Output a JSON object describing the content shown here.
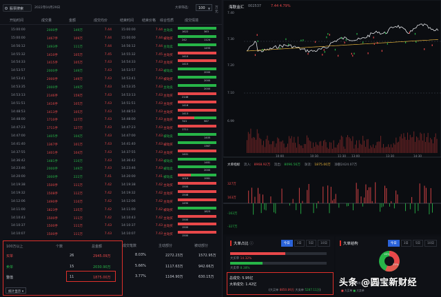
{
  "left": {
    "search_text": "股票搜索",
    "date_text": "2022年04月29日",
    "filter_label": "大单筛选:",
    "filter_value": "100",
    "filter_unit": "万元",
    "headers": [
      "开始时间",
      "成交量",
      "金额",
      "成交均价",
      "结束时间",
      "结束价格",
      "综合性质",
      "成交情境"
    ],
    "rows": [
      {
        "t": "15:00:00",
        "vol": "2000手",
        "amt": "149万",
        "price": "7.44",
        "et": "15:00:00",
        "ep": "7.44",
        "nat": "主动卖",
        "buy": 1622,
        "sell": 363,
        "bar": "green"
      },
      {
        "t": "15:00:00",
        "vol": "1467手",
        "amt": "109万",
        "price": "7.44",
        "et": "15:00:00",
        "ep": "7.44",
        "nat": "被动买",
        "buy": 242,
        "sell": 1124,
        "bar": "green"
      },
      {
        "t": "14:56:12",
        "vol": "1493手",
        "amt": "111万",
        "price": "7.44",
        "et": "14:56:12",
        "ep": "7.44",
        "nat": "主动卖",
        "buy": 0,
        "sell": 1493,
        "bar": "green"
      },
      {
        "t": "14:55:32",
        "vol": "1410手",
        "amt": "105万",
        "price": "7.45",
        "et": "14:55:32",
        "ep": "7.45",
        "nat": "主动买",
        "buy": 1410,
        "sell": 0,
        "bar": "red"
      },
      {
        "t": "14:54:33",
        "vol": "1415手",
        "amt": "105万",
        "price": "7.43",
        "et": "14:54:33",
        "ep": "7.43",
        "nat": "主动买",
        "buy": 1415,
        "sell": 0,
        "bar": "red"
      },
      {
        "t": "14:53:57",
        "vol": "2000手",
        "amt": "149万",
        "price": "7.43",
        "et": "14:53:57",
        "ep": "7.43",
        "nat": "被动卖",
        "buy": 0,
        "sell": 2000,
        "bar": "green"
      },
      {
        "t": "14:53:41",
        "vol": "2000手",
        "amt": "149万",
        "price": "7.43",
        "et": "14:53:41",
        "ep": "7.43",
        "nat": "被动买",
        "buy": 0,
        "sell": 2000,
        "bar": "green"
      },
      {
        "t": "14:53:35",
        "vol": "2000手",
        "amt": "149万",
        "price": "7.43",
        "et": "14:53:35",
        "ep": "7.43",
        "nat": "主动卖",
        "buy": 0,
        "sell": 2000,
        "bar": "green"
      },
      {
        "t": "14:53:13",
        "vol": "2146手",
        "amt": "159万",
        "price": "7.43",
        "et": "14:53:13",
        "ep": "7.43",
        "nat": "主动买",
        "buy": 2146,
        "sell": 0,
        "bar": "red"
      },
      {
        "t": "14:51:51",
        "vol": "1416手",
        "amt": "105万",
        "price": "7.43",
        "et": "14:51:51",
        "ep": "7.43",
        "nat": "主动买",
        "buy": 1416,
        "sell": 0,
        "bar": "red"
      },
      {
        "t": "14:48:53",
        "vol": "1413手",
        "amt": "105万",
        "price": "7.43",
        "et": "14:48:53",
        "ep": "7.43",
        "nat": "主动买",
        "buy": 1413,
        "sell": 0,
        "bar": "red"
      },
      {
        "t": "14:48:00",
        "vol": "1710手",
        "amt": "127万",
        "price": "7.43",
        "et": "14:48:00",
        "ep": "7.43",
        "nat": "主动买",
        "buy": 743,
        "sell": 967,
        "bar": "mixed"
      },
      {
        "t": "14:47:23",
        "vol": "1711手",
        "amt": "127万",
        "price": "7.43",
        "et": "14:47:23",
        "ep": "7.43",
        "nat": "主动买",
        "buy": 1711,
        "sell": 0,
        "bar": "red"
      },
      {
        "t": "14:47:00",
        "vol": "1405手",
        "amt": "104万",
        "price": "7.43",
        "et": "14:47:00",
        "ep": "7.43",
        "nat": "被动卖",
        "buy": 0,
        "sell": 1405,
        "bar": "green"
      },
      {
        "t": "14:41:40",
        "vol": "1367手",
        "amt": "101万",
        "price": "7.43",
        "et": "14:41:40",
        "ep": "7.43",
        "nat": "被动买",
        "buy": 0,
        "sell": 1367,
        "bar": "green"
      },
      {
        "t": "14:37:55",
        "vol": "1401手",
        "amt": "104万",
        "price": "7.43",
        "et": "14:37:55",
        "ep": "7.43",
        "nat": "主动买",
        "buy": 1401,
        "sell": 0,
        "bar": "red"
      },
      {
        "t": "14:36:42",
        "vol": "1481手",
        "amt": "110万",
        "price": "7.43",
        "et": "14:36:42",
        "ep": "7.43",
        "nat": "被动卖",
        "buy": 0,
        "sell": 1481,
        "bar": "green"
      },
      {
        "t": "14:23:46",
        "vol": "2000手",
        "amt": "149万",
        "price": "7.43",
        "et": "14:23:46",
        "ep": "7.43",
        "nat": "被动卖",
        "buy": 0,
        "sell": 2000,
        "bar": "green"
      },
      {
        "t": "14:20:00",
        "vol": "3000手",
        "amt": "222万",
        "price": "7.41",
        "et": "14:20:00",
        "ep": "7.41",
        "nat": "被动卖",
        "buy": 1019,
        "sell": 1981,
        "bar": "mixed"
      },
      {
        "t": "14:19:38",
        "vol": "1500手",
        "amt": "111万",
        "price": "7.42",
        "et": "14:19:38",
        "ep": "7.42",
        "nat": "主动买",
        "buy": 1500,
        "sell": 0,
        "bar": "red"
      },
      {
        "t": "14:19:32",
        "vol": "1508手",
        "amt": "112万",
        "price": "7.42",
        "et": "14:19:32",
        "ep": "7.42",
        "nat": "主动买",
        "buy": 1508,
        "sell": 0,
        "bar": "red"
      },
      {
        "t": "14:12:06",
        "vol": "1490手",
        "amt": "110万",
        "price": "7.42",
        "et": "14:12:06",
        "ep": "7.42",
        "nat": "主动买",
        "buy": 1490,
        "sell": 0,
        "bar": "red"
      },
      {
        "t": "14:11:00",
        "vol": "1823手",
        "amt": "135万",
        "price": "7.42",
        "et": "14:11:00",
        "ep": "7.42",
        "nat": "被动买",
        "buy": 0,
        "sell": 1823,
        "bar": "green"
      },
      {
        "t": "14:10:43",
        "vol": "1500手",
        "amt": "111万",
        "price": "7.42",
        "et": "14:10:43",
        "ep": "7.42",
        "nat": "主动买",
        "buy": 1500,
        "sell": 0,
        "bar": "red"
      },
      {
        "t": "14:10:37",
        "vol": "1500手",
        "amt": "111万",
        "price": "7.43",
        "et": "14:10:37",
        "ep": "7.43",
        "nat": "主动买",
        "buy": 1500,
        "sell": 0,
        "bar": "red"
      },
      {
        "t": "14:10:07",
        "vol": "1500手",
        "amt": "111万",
        "price": "7.43",
        "et": "14:10:07",
        "ep": "7.43",
        "nat": "主动买",
        "buy": 1500,
        "sell": 0,
        "bar": "red"
      }
    ]
  },
  "summary": {
    "headers": [
      "100万以上",
      "个数",
      "总金额",
      "成交笔数",
      "主动部分",
      "被动部分"
    ],
    "rows": [
      {
        "label": "买单",
        "count": "26",
        "amount": "2945.09万",
        "pct": "8.03%",
        "active": "2272.23万",
        "passive": "1572.95万"
      },
      {
        "label": "卖单",
        "count": "15",
        "amount": "2030.90万",
        "pct": "5.66%",
        "active": "1117.63万",
        "passive": "942.66万"
      },
      {
        "label": "整值",
        "count": "11",
        "amount": "1875.00万",
        "pct": "3.77%",
        "active": "1104.90万",
        "passive": "630.15万"
      }
    ],
    "button": "统计显示"
  },
  "chart": {
    "name": "海联金汇",
    "code": "002537",
    "price": "7.44",
    "change": "4.79%",
    "ylabels": [
      "7.40",
      "7.30",
      "7.20",
      "7.10",
      "6.99",
      "6.67"
    ],
    "xlabels": [
      "10:00",
      "10:30",
      "11:30",
      "13:00",
      "13:30",
      "14:30",
      "15:00"
    ],
    "big_head": [
      "大单指标",
      "流入:",
      "8968.92万",
      "流出:",
      "8096.56万",
      "净流:",
      "1875.00万",
      "净额2424.07万"
    ],
    "big_y": [
      "327万",
      "163万",
      "0",
      "-163万",
      "-327万",
      "-653万"
    ]
  },
  "ratio": {
    "title": "大单占比",
    "tabs": [
      "今日",
      "3日",
      "5日",
      "10日"
    ],
    "buy_label": "大买单",
    "buy_pct": "14.32%",
    "sell_label": "大卖单",
    "sell_pct": "8.38%",
    "total_label": "总成交:",
    "total_val": "5.95亿",
    "big_label": "大单成交:",
    "big_val": "1.42亿",
    "big_buy_label": "大买单",
    "big_buy_val": "8850.89万",
    "big_sell_label": "大卖单",
    "big_sell_val": "5287.11万"
  },
  "struct": {
    "title": "大单结构",
    "tabs": [
      "今日",
      "3日",
      "5日",
      "10日"
    ],
    "pie_pct_a": "16%",
    "pie_pct_b": "25%",
    "footnote": "大单类占比（大单成交额占当日成交额）",
    "legend_buy": "大买单",
    "legend_sell": "大卖单"
  },
  "watermark": "头条 @圆宝新财经",
  "colors": {
    "red": "#e8484a",
    "green": "#27b548",
    "accent": "#2b63d9",
    "frame": "#e0302b"
  }
}
